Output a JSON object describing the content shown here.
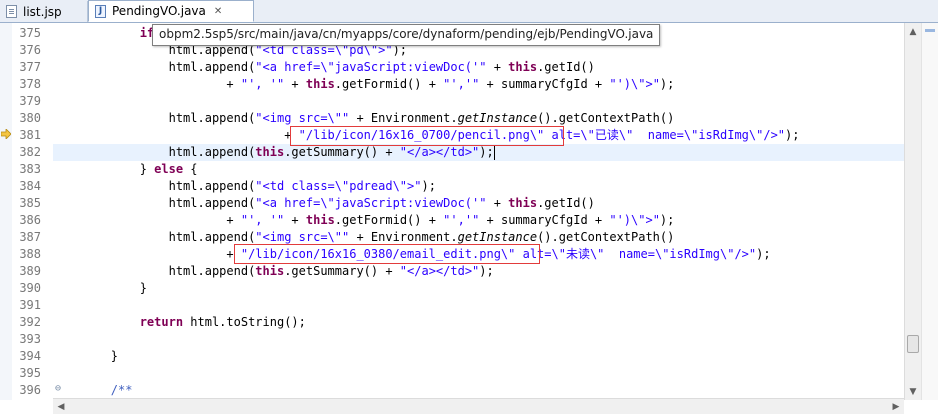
{
  "tabs": [
    {
      "label": "list.jsp",
      "active": false
    },
    {
      "label": "PendingVO.java",
      "active": true
    }
  ],
  "tooltip": "obpm2.5sp5/src/main/java/cn/myapps/core/dynaform/pending/ejb/PendingVO.java",
  "lines": [
    {
      "no": "375",
      "code": "            if "
    },
    {
      "no": "376",
      "code": "                html.append(\"<td class=\\\"pd\\\">\");"
    },
    {
      "no": "377",
      "code": "                html.append(\"<a href=\\\"javaScript:viewDoc('\" + this.getId()"
    },
    {
      "no": "378",
      "code": "                        + \"', '\" + this.getFormid() + \"','\" + summaryCfgId + \"')\\\">\");"
    },
    {
      "no": "379",
      "code": ""
    },
    {
      "no": "380",
      "code": "                html.append(\"<img src=\\\"\" + Environment.getInstance().getContextPath()"
    },
    {
      "no": "381",
      "code": "                                + \"/lib/icon/16x16_0700/pencil.png\\\" alt=\\\"已读\\\"  name=\\\"isRdImg\\\"/>\");"
    },
    {
      "no": "382",
      "code": "                html.append(this.getSummary() + \"</a></td>\");"
    },
    {
      "no": "383",
      "code": "            } else {"
    },
    {
      "no": "384",
      "code": "                html.append(\"<td class=\\\"pdread\\\">\");"
    },
    {
      "no": "385",
      "code": "                html.append(\"<a href=\\\"javaScript:viewDoc('\" + this.getId()"
    },
    {
      "no": "386",
      "code": "                        + \"', '\" + this.getFormid() + \"','\" + summaryCfgId + \"')\\\">\");"
    },
    {
      "no": "387",
      "code": "                html.append(\"<img src=\\\"\" + Environment.getInstance().getContextPath()"
    },
    {
      "no": "388",
      "code": "                        + \"/lib/icon/16x16_0380/email_edit.png\\\" alt=\\\"未读\\\"  name=\\\"isRdImg\\\"/>\");"
    },
    {
      "no": "389",
      "code": "                html.append(this.getSummary() + \"</a></td>\");"
    },
    {
      "no": "390",
      "code": "            }"
    },
    {
      "no": "391",
      "code": ""
    },
    {
      "no": "392",
      "code": "            return html.toString();"
    },
    {
      "no": "393",
      "code": ""
    },
    {
      "no": "394",
      "code": "        }"
    },
    {
      "no": "395",
      "code": ""
    },
    {
      "no": "396",
      "code": "        /**"
    }
  ],
  "colors": {
    "keyword": "#7f0055",
    "string": "#2a00ff",
    "comment": "#3f5fbf",
    "current_line": "#e8f2fe",
    "annotation_box": "#e23b3b"
  },
  "icons": {
    "jsp_tab": "file-icon",
    "java_tab": "java-file-icon",
    "close_tab": "close-icon",
    "debug_marker": "arrow-marker-icon",
    "fold_collapse": "fold-minus-icon"
  }
}
